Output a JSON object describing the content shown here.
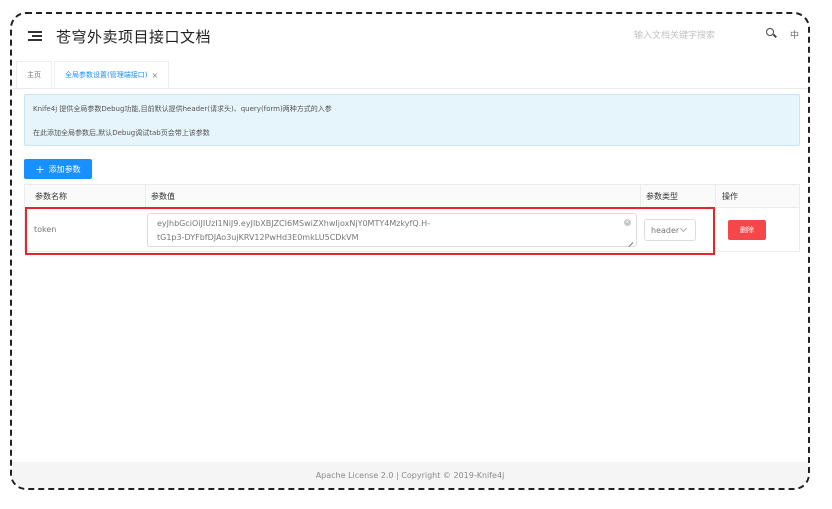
{
  "header": {
    "title": "苍穹外卖项目接口文档",
    "search_placeholder": "输入文档关键字搜索",
    "lang": "中"
  },
  "tabs": [
    {
      "label": "主页"
    },
    {
      "label": "全局参数设置(管理端接口)",
      "close": "×"
    }
  ],
  "alert": {
    "line1": "Knife4j 提供全局参数Debug功能,目前默认提供header(请求头)、query(form)两种方式的入参",
    "line2": "在此添加全局参数后,默认Debug调试tab页会带上该参数"
  },
  "add_button": {
    "icon": "+",
    "label": "添加参数"
  },
  "table": {
    "headers": [
      "参数名称",
      "参数值",
      "参数类型",
      "操作"
    ],
    "row": {
      "name": "token",
      "value_line1": "eyJhbGciOiJIUzI1NiJ9.eyJlbXBJZCI6MSwiZXhwIjoxNjY0MTY4MzkyfQ.H-",
      "value_line2": "tG1p3-DYFbfDJAo3ujKRV12PwHd3E0mkLU5CDkVM",
      "type": "header",
      "delete_label": "删除"
    }
  },
  "footer": {
    "text": "Apache License 2.0 | Copyright © 2019-Knife4j"
  }
}
